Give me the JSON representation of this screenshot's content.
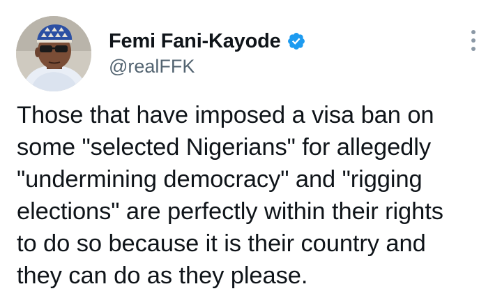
{
  "author": {
    "display_name": "Femi Fani-Kayode",
    "handle": "@realFFK",
    "verified": true,
    "avatar_icon": "profile-photo"
  },
  "tweet": {
    "lines": [
      "Those that have imposed a visa ban on",
      "some \"selected Nigerians\" for allegedly",
      "\"undermining democracy\" and \"rigging",
      "elections\" are perfectly within their rights",
      "to do so because it is their country and",
      "they can do as they please."
    ]
  },
  "icons": {
    "verified": "verified-badge-icon",
    "more": "more-options-icon"
  },
  "colors": {
    "verified_badge": "#1d9bf0",
    "text": "#0f1419",
    "secondary_text": "#536471",
    "more_dots": "#8b98a5"
  }
}
